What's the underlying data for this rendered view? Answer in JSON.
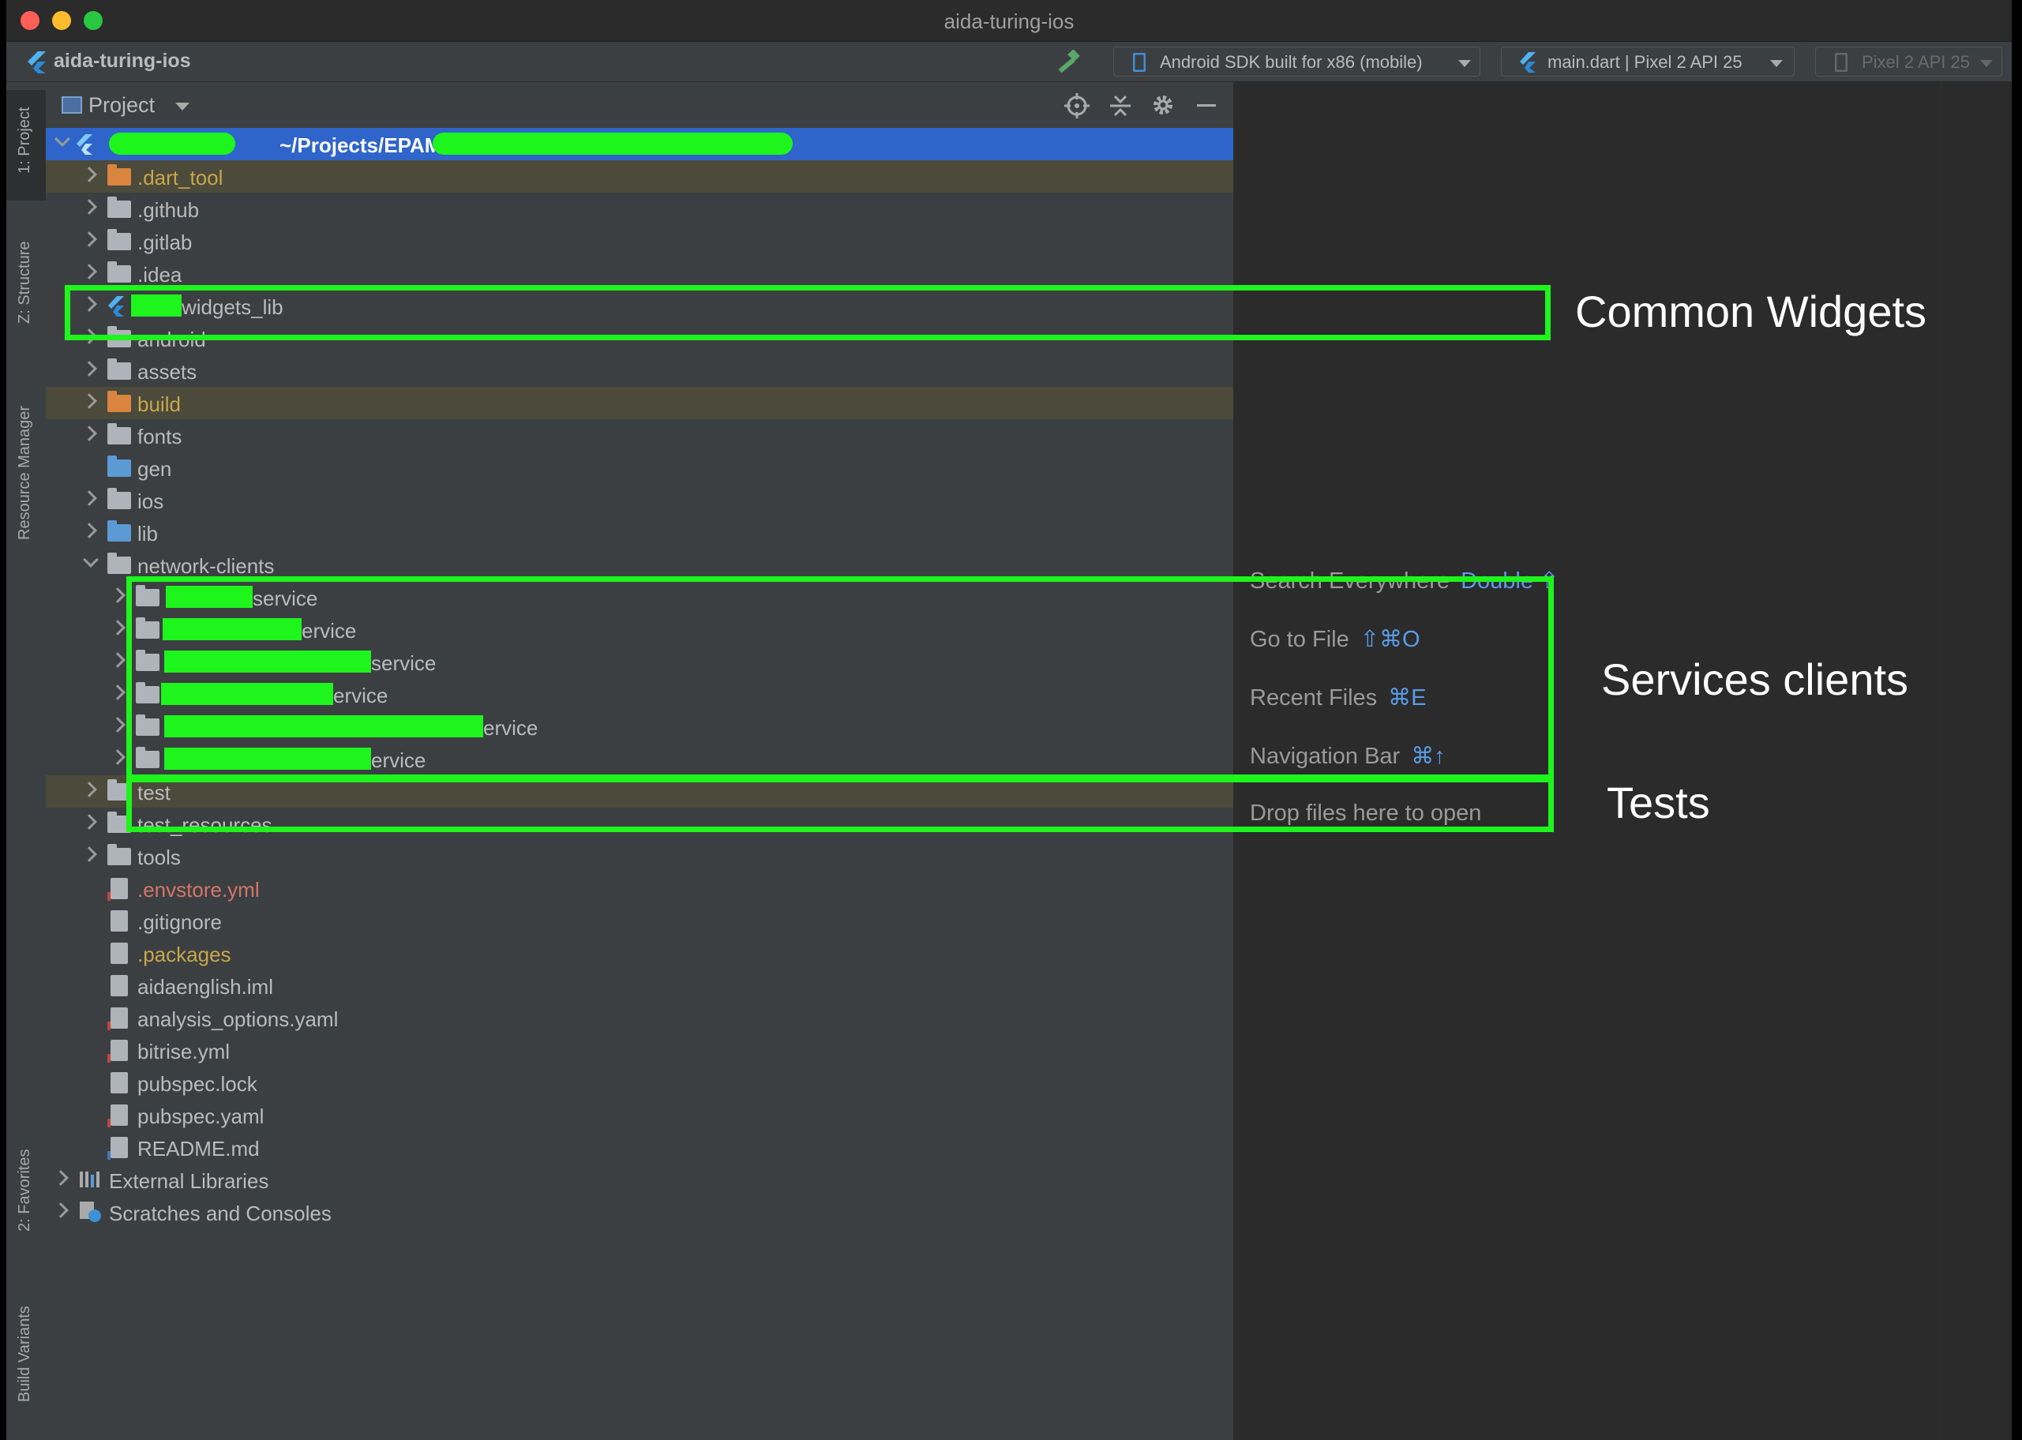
{
  "window": {
    "title": "aida-turing-ios",
    "traffic_lights": {
      "close": "#ff5f57",
      "minimize": "#febc2e",
      "zoom": "#28c840"
    }
  },
  "toolbar": {
    "project_name": "aida-turing-ios",
    "device_selector": "Android SDK built for x86 (mobile)",
    "run_config": "main.dart | Pixel 2 API 25",
    "target_device": "Pixel 2 API 25"
  },
  "left_strip": {
    "tabs": [
      "1: Project",
      "Z: Structure",
      "Resource Manager",
      "2: Favorites",
      "Build Variants"
    ]
  },
  "project_panel": {
    "title": "Project",
    "root_path": "~/Projects/EPAM/",
    "tree": [
      {
        "label": ".dart_tool",
        "kind": "folder",
        "color": "orange"
      },
      {
        "label": ".github",
        "kind": "folder"
      },
      {
        "label": ".gitlab",
        "kind": "folder"
      },
      {
        "label": ".idea",
        "kind": "folder"
      },
      {
        "label": "widgets_lib",
        "kind": "flutter"
      },
      {
        "label": "android",
        "kind": "folder"
      },
      {
        "label": "assets",
        "kind": "folder"
      },
      {
        "label": "build",
        "kind": "folder",
        "color": "orange"
      },
      {
        "label": "fonts",
        "kind": "folder"
      },
      {
        "label": "gen",
        "kind": "folder-blue"
      },
      {
        "label": "ios",
        "kind": "folder"
      },
      {
        "label": "lib",
        "kind": "folder-blue"
      },
      {
        "label": "network-clients",
        "kind": "folder"
      },
      {
        "label": "service",
        "kind": "folder"
      },
      {
        "label": "ervice",
        "kind": "folder"
      },
      {
        "label": "service",
        "kind": "folder"
      },
      {
        "label": "ervice",
        "kind": "folder"
      },
      {
        "label": "ervice",
        "kind": "folder"
      },
      {
        "label": "ervice",
        "kind": "folder"
      },
      {
        "label": "test",
        "kind": "folder"
      },
      {
        "label": "test_resources",
        "kind": "folder"
      },
      {
        "label": "tools",
        "kind": "folder"
      },
      {
        "label": ".envstore.yml",
        "kind": "file",
        "color": "red"
      },
      {
        "label": ".gitignore",
        "kind": "file"
      },
      {
        "label": ".packages",
        "kind": "file",
        "color": "orange"
      },
      {
        "label": "aidaenglish.iml",
        "kind": "file"
      },
      {
        "label": "analysis_options.yaml",
        "kind": "file"
      },
      {
        "label": "bitrise.yml",
        "kind": "file"
      },
      {
        "label": "pubspec.lock",
        "kind": "file"
      },
      {
        "label": "pubspec.yaml",
        "kind": "file"
      },
      {
        "label": "README.md",
        "kind": "file"
      },
      {
        "label": "External Libraries",
        "kind": "lib"
      },
      {
        "label": "Scratches and Consoles",
        "kind": "scratch"
      }
    ]
  },
  "editor_hints": {
    "search": {
      "label": "Search Everywhere",
      "key": "Double ⇧"
    },
    "goto": {
      "label": "Go to File",
      "key": "⇧⌘O"
    },
    "recent": {
      "label": "Recent Files",
      "key": "⌘E"
    },
    "navbar": {
      "label": "Navigation Bar",
      "key": "⌘↑"
    },
    "drop": {
      "label": "Drop files here to open"
    }
  },
  "annotations": {
    "common_widgets": "Common Widgets",
    "services_clients": "Services clients",
    "tests": "Tests",
    "highlight_color": "#1df51d"
  }
}
